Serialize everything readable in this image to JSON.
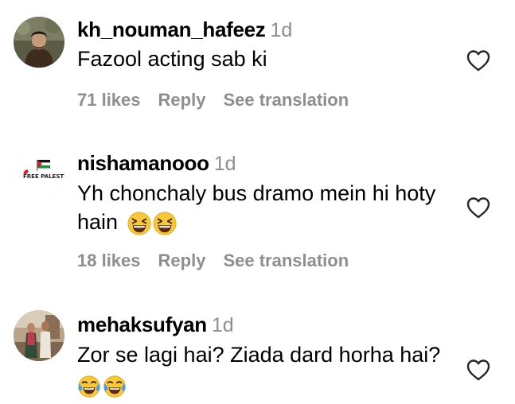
{
  "comments": [
    {
      "username": "kh_nouman_hafeez",
      "time": "1d",
      "text": "Fazool acting sab ki",
      "likes": "71 likes",
      "reply": "Reply",
      "see_translation": "See translation",
      "avatar_icon": "profile-photo",
      "like_icon": "heart-outline-icon"
    },
    {
      "username": "nishamanooo",
      "time": "1d",
      "text_line1": "Yh chonchaly bus dramo mein hi hoty",
      "text_line2": "hain",
      "emojis": [
        "grinning-squinting-face-emoji",
        "grinning-squinting-face-emoji"
      ],
      "likes": "18 likes",
      "reply": "Reply",
      "see_translation": "See translation",
      "avatar_icon": "palestine-flag-logo",
      "avatar_text": "FREE PALESTINE",
      "like_icon": "heart-outline-icon"
    },
    {
      "username": "mehaksufyan",
      "time": "1d",
      "text": "Zor se lagi hai? Ziada dard horha hai?",
      "emojis": [
        "face-with-tears-of-joy-emoji",
        "face-with-tears-of-joy-emoji"
      ],
      "avatar_icon": "couple-photo",
      "like_icon": "heart-outline-icon"
    }
  ],
  "colors": {
    "text": "#000000",
    "muted": "#8e8e8e",
    "emoji_yellow": "#f9c83a",
    "tear_blue": "#4a9fe0",
    "palestine_red": "#d0202a",
    "palestine_green": "#1f8b3c"
  }
}
